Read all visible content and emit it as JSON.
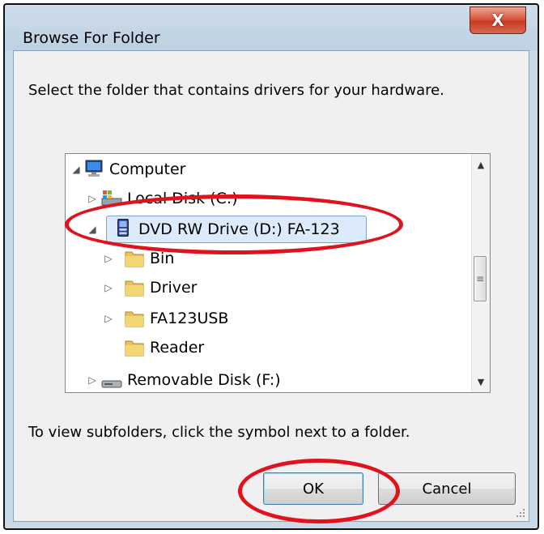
{
  "window": {
    "title": "Browse For Folder",
    "close_glyph": "X"
  },
  "instruction": "Select the folder that contains drivers for your hardware.",
  "tree": {
    "items": [
      {
        "label": "Computer",
        "icon": "computer-icon",
        "expander": "expanded"
      },
      {
        "label": "Local Disk (C:)",
        "icon": "local-disk-icon",
        "expander": "collapsed"
      },
      {
        "label": "DVD RW Drive (D:) FA-123",
        "icon": "dvd-drive-icon",
        "expander": "expanded",
        "selected": true
      },
      {
        "label": "Bin",
        "icon": "folder-icon",
        "expander": "collapsed"
      },
      {
        "label": "Driver",
        "icon": "folder-icon",
        "expander": "collapsed"
      },
      {
        "label": "FA123USB",
        "icon": "folder-icon",
        "expander": "collapsed"
      },
      {
        "label": "Reader",
        "icon": "folder-icon",
        "expander": "none"
      },
      {
        "label": "Removable Disk (F:)",
        "icon": "removable-disk-icon",
        "expander": "collapsed"
      }
    ]
  },
  "hint": "To view subfolders, click the symbol next to a folder.",
  "buttons": {
    "ok": "OK",
    "cancel": "Cancel"
  },
  "annotation_color": "#e0121b"
}
